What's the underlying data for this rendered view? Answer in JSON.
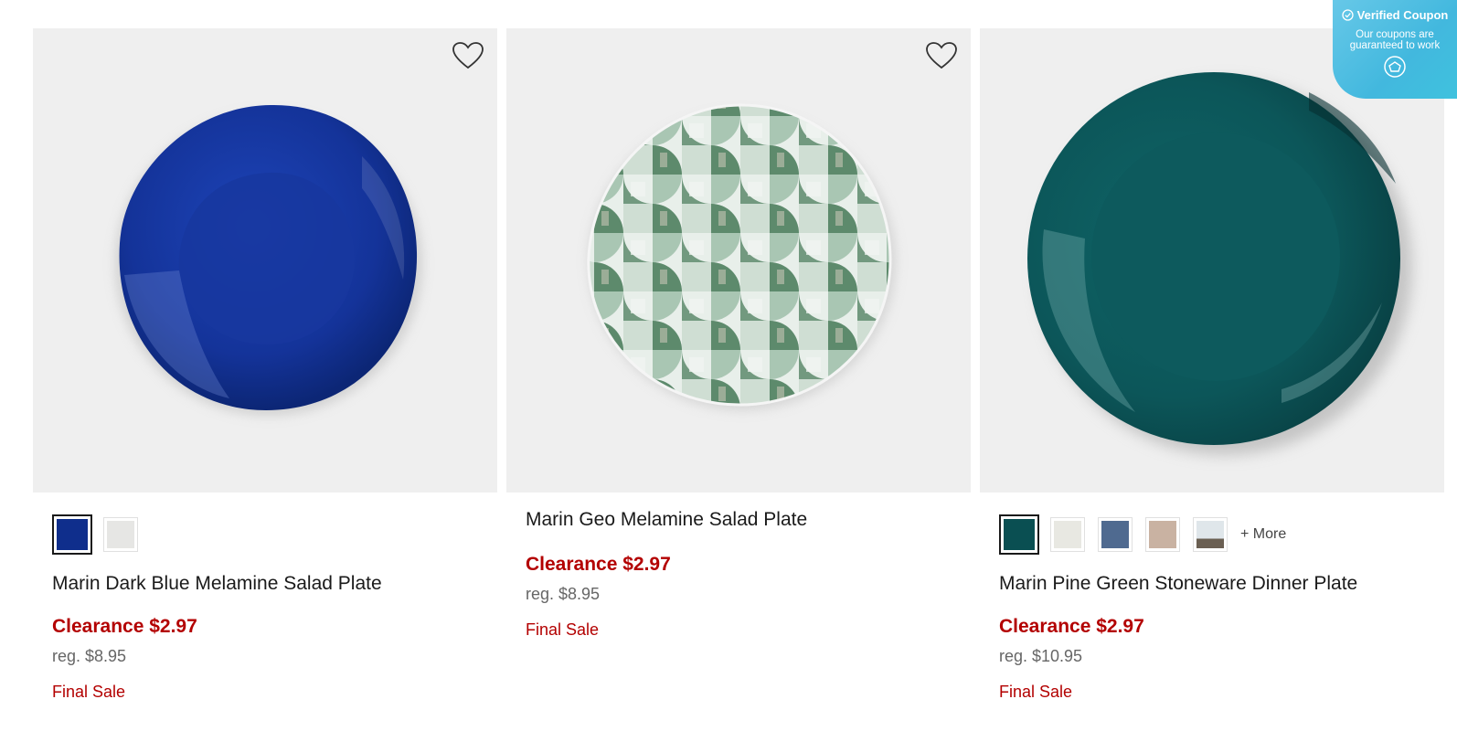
{
  "products": [
    {
      "title": "Marin Dark Blue Melamine Salad Plate",
      "clearance": "Clearance $2.97",
      "regular": "reg. $8.95",
      "final": "Final Sale",
      "swatches": [
        "#0f2e8c",
        "#e6e6e4"
      ],
      "selected_swatch": 0,
      "plate_colors": {
        "base": "#15349f",
        "rim": "#0d2a86",
        "center": "#1a3eb0"
      }
    },
    {
      "title": "Marin Geo Melamine Salad Plate",
      "clearance": "Clearance $2.97",
      "regular": "reg. $8.95",
      "final": "Final Sale",
      "swatches": [],
      "plate_colors": {
        "base": "#e6ede8",
        "pattern": "#5d8a6c",
        "pattern_light": "#a9c6b3"
      }
    },
    {
      "title": "Marin Pine Green Stoneware Dinner Plate",
      "clearance": "Clearance $2.97",
      "regular": "reg. $10.95",
      "final": "Final Sale",
      "swatches": [
        "#0a4f52",
        "#e8e8e2",
        "#4f6a90",
        "#c9b2a2",
        "#dfe6ea"
      ],
      "selected_swatch": 0,
      "more_label": "+ More",
      "plate_colors": {
        "base": "#0e5f61",
        "rim": "#0a4d50",
        "center": "#0c5558"
      }
    }
  ],
  "coupon": {
    "title": "Verified Coupon",
    "subtitle": "Our coupons are guaranteed to work"
  },
  "colors": {
    "sale_red": "#b30000",
    "coupon_blue": "#42b8de"
  }
}
